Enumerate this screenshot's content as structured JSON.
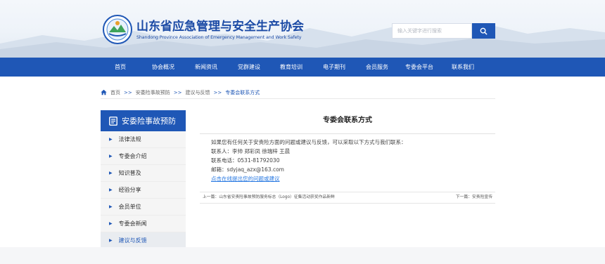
{
  "header": {
    "logo_cn": "山东省应急管理与安全生产协会",
    "logo_en": "Shandong Province Association of Emergency Management and Work Safety",
    "search_placeholder": "输入关键字进行搜索",
    "colors": {
      "brand": "#1f57b6"
    }
  },
  "nav": {
    "items": [
      {
        "label": "首页"
      },
      {
        "label": "协会概况"
      },
      {
        "label": "新闻资讯"
      },
      {
        "label": "党群建设"
      },
      {
        "label": "教育培训"
      },
      {
        "label": "电子期刊"
      },
      {
        "label": "会员服务"
      },
      {
        "label": "专委会平台"
      },
      {
        "label": "联系我们"
      }
    ]
  },
  "breadcrumb": {
    "home": "首页",
    "sep": ">>",
    "level1": "安委险事故预防",
    "level2": "建议与反馈",
    "current": "专委会联系方式"
  },
  "sidebar": {
    "title": "安委险事故预防",
    "items": [
      {
        "label": "法律法规"
      },
      {
        "label": "专委会介绍"
      },
      {
        "label": "知识普及"
      },
      {
        "label": "经验分享"
      },
      {
        "label": "会员单位"
      },
      {
        "label": "专委会新闻"
      },
      {
        "label": "建议与反馈"
      }
    ]
  },
  "article": {
    "title": "专委会联系方式",
    "intro": "如果您有任何关于安责险方面的问题或建议与反馈，可以采取以下方式与我们联系：",
    "contacts": "联系人：李帅 郑彩凤 徐瑞梓 王晨",
    "phone": "联系电话：0531-81792030",
    "email": "邮箱：sdyjaq_azx@163.com",
    "feedback_link": "点击在线提出您的问题或建议"
  },
  "pager": {
    "prev": "上一篇：山东省安责险事故预防服务标志（Logo）征集活动获奖作品新鲜",
    "next": "下一篇：安责险宣传"
  }
}
